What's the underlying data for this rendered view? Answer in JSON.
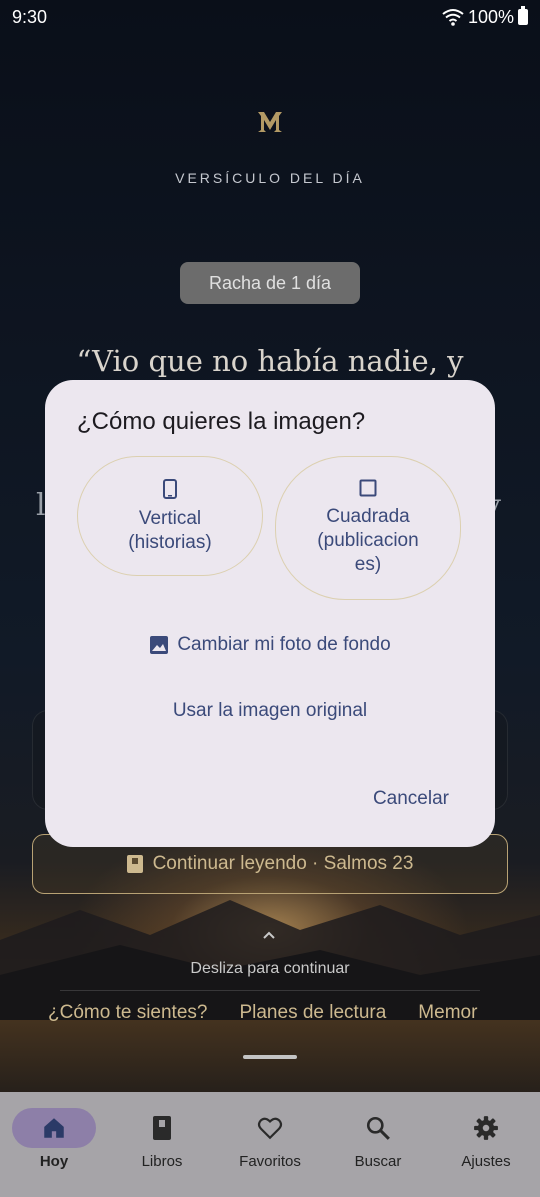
{
  "status_bar": {
    "time": "9:30",
    "battery": "100%"
  },
  "header": {
    "eyebrow": "VERSÍCULO DEL DÍA"
  },
  "streak": {
    "label": "Racha de 1 día"
  },
  "verse": {
    "first_line": "“Vio que no había nadie, y",
    "fragment_left": "l",
    "fragment_right": "y"
  },
  "continue_reading": {
    "label": "Continuar leyendo · Salmos 23"
  },
  "swipe_hint": "Desliza para continuar",
  "quick_links": [
    {
      "label": "¿Cómo te sientes?"
    },
    {
      "label": "Planes de lectura"
    },
    {
      "label": "Memor"
    }
  ],
  "bottom_nav": [
    {
      "label": "Hoy",
      "icon": "home-icon",
      "active": true
    },
    {
      "label": "Libros",
      "icon": "book-icon",
      "active": false
    },
    {
      "label": "Favoritos",
      "icon": "heart-icon",
      "active": false
    },
    {
      "label": "Buscar",
      "icon": "search-icon",
      "active": false
    },
    {
      "label": "Ajustes",
      "icon": "gear-icon",
      "active": false
    }
  ],
  "dialog": {
    "title": "¿Cómo quieres la imagen?",
    "options": [
      {
        "label": "Vertical (historias)",
        "line1": "Vertical",
        "line2": "(historias)",
        "icon": "phone-portrait-icon"
      },
      {
        "label": "Cuadrada (publicaciones)",
        "line1": "Cuadrada",
        "line2": "(publicacion",
        "line3": "es)",
        "icon": "square-icon"
      }
    ],
    "change_photo": {
      "label": "Cambiar mi foto de fondo",
      "icon": "image-icon"
    },
    "use_original": {
      "label": "Usar la imagen original"
    },
    "cancel": {
      "label": "Cancelar"
    }
  },
  "colors": {
    "accent_gold": "#cdb98f",
    "dialog_bg": "#ece7ef",
    "dialog_accent": "#3b4a7a",
    "nav_active": "#8d7fa8"
  }
}
